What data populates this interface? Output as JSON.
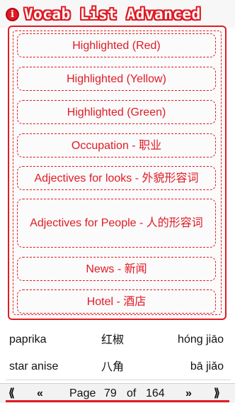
{
  "header": {
    "title": "Vocab List Advanced",
    "info_glyph": "i"
  },
  "lists": [
    "Highlighted (Red)",
    "Highlighted (Yellow)",
    "Highlighted (Green)",
    "Occupation  -  职业",
    "Adjectives for looks  -  外貌形容词",
    "Adjectives for People  -  人的形容词",
    "News  -  新闻",
    "Hotel  -  酒店"
  ],
  "vocab_rows": [
    {
      "english": "paprika",
      "chinese": "红椒",
      "pinyin": "hóng jiāo"
    },
    {
      "english": "star anise",
      "chinese": "八角",
      "pinyin": "bā jiǎo"
    }
  ],
  "pager": {
    "first": "⟪",
    "prev": "«",
    "page_label": "Page",
    "current": "79",
    "of_label": "of",
    "total": "164",
    "next": "»",
    "last": "⟫"
  },
  "colors": {
    "accent": "#e01b24",
    "popup_bg": "#fbfbfb"
  }
}
